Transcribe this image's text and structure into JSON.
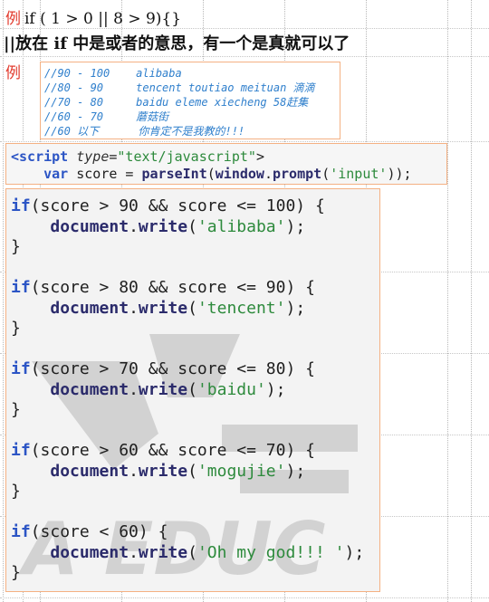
{
  "doc": {
    "example_mark": "例",
    "line1_code": "if ( 1 > 0 || 8 > 9){}",
    "line2_note": "||放在 if 中是或者的意思，有一个是真就可以了",
    "example_mark2": "例"
  },
  "comments": [
    "//90 - 100    alibaba",
    "//80 - 90     tencent toutiao meituan 滴滴",
    "//70 - 80     baidu eleme xiecheng 58赶集",
    "//60 - 70     蘑菇街",
    "//60 以下      你肯定不是我教的!!!"
  ],
  "script": {
    "tag_open": "<script",
    "attr_name": "type",
    "attr_value": "\"text/javascript\"",
    "tag_close": ">",
    "var_kw": "var",
    "var_rest": " score = ",
    "parse_fn": "parseInt",
    "paren_open": "(",
    "window_obj": "window",
    "dot": ".",
    "prompt_fn": "prompt",
    "arg": "'input'",
    "end": "));"
  },
  "blocks": [
    {
      "cond": "(score > 90 && score <= 100) {",
      "arg": "'alibaba'"
    },
    {
      "cond": "(score > 80 && score <= 90) {",
      "arg": "'tencent'"
    },
    {
      "cond": "(score > 70 && score <= 80) {",
      "arg": "'baidu'"
    },
    {
      "cond": "(score > 60 && score <= 70) {",
      "arg": "'mogujie'"
    },
    {
      "cond": "(score < 60) {",
      "arg": "'Oh my god!!! '"
    }
  ],
  "code_tokens": {
    "if_kw": "if",
    "doc_obj": "document",
    "dot": ".",
    "write_fn": "write",
    "paren_open": "(",
    "call_end": ");",
    "close_brace": "}"
  },
  "watermark": {
    "text": "A EDUC"
  }
}
